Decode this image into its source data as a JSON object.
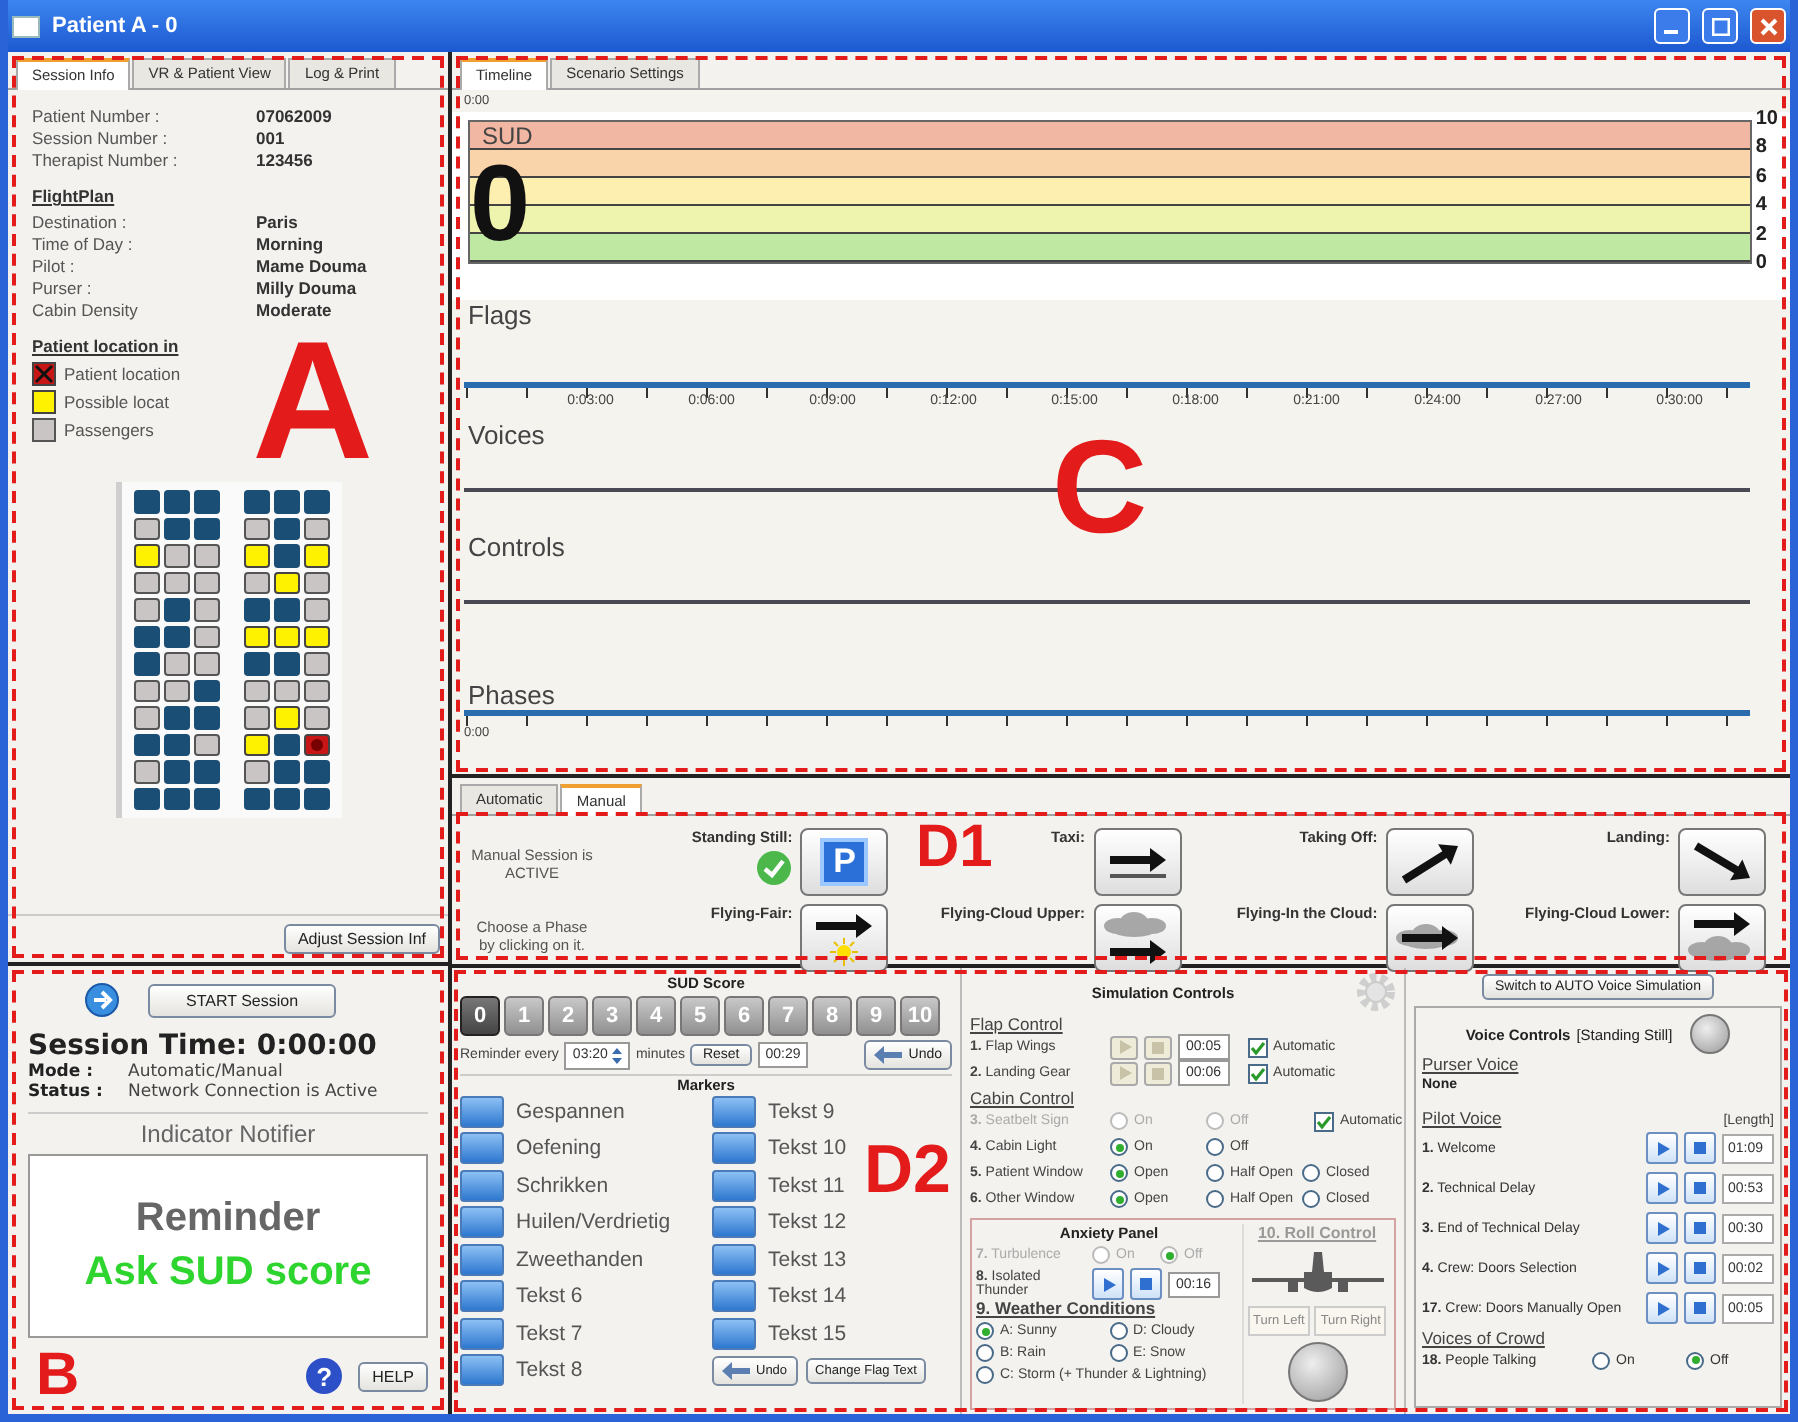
{
  "window": {
    "title": "Patient A - 0"
  },
  "session": {
    "annotation": "A",
    "tabs": [
      {
        "label": "Session Info",
        "selected": true
      },
      {
        "label": "VR & Patient View",
        "selected": false
      },
      {
        "label": "Log & Print",
        "selected": false
      }
    ],
    "info": [
      {
        "label": "Patient Number :",
        "value": "07062009"
      },
      {
        "label": "Session Number :",
        "value": "001"
      },
      {
        "label": "Therapist Number :",
        "value": "123456"
      }
    ],
    "flight_plan": {
      "heading": "FlightPlan",
      "rows": [
        {
          "label": "Destination :",
          "value": "Paris"
        },
        {
          "label": "Time of Day :",
          "value": "Morning"
        },
        {
          "label": "Pilot :",
          "value": "Mame Douma"
        },
        {
          "label": "Purser :",
          "value": "Milly Douma"
        },
        {
          "label": "Cabin Density",
          "value": "Moderate"
        }
      ]
    },
    "location": {
      "heading": "Patient location in",
      "legend": [
        {
          "label": "Patient location",
          "kind": "patient"
        },
        {
          "label": "Possible locat",
          "kind": "possible"
        },
        {
          "label": "Passengers",
          "kind": "passenger"
        }
      ]
    },
    "seat_rows": [
      [
        {
          "kind": "empty"
        },
        {
          "kind": "empty"
        },
        {
          "kind": "empty"
        },
        {
          "kind": "empty"
        },
        {
          "kind": "empty"
        },
        {
          "kind": "empty"
        }
      ],
      [
        {
          "kind": "passenger"
        },
        {
          "kind": "empty"
        },
        {
          "kind": "empty"
        },
        {
          "kind": "passenger"
        },
        {
          "kind": "empty"
        },
        {
          "kind": "passenger"
        }
      ],
      [
        {
          "kind": "possible"
        },
        {
          "kind": "passenger"
        },
        {
          "kind": "passenger"
        },
        {
          "kind": "possible"
        },
        {
          "kind": "empty"
        },
        {
          "kind": "possible"
        }
      ],
      [
        {
          "kind": "passenger"
        },
        {
          "kind": "passenger"
        },
        {
          "kind": "passenger"
        },
        {
          "kind": "passenger"
        },
        {
          "kind": "possible"
        },
        {
          "kind": "passenger"
        }
      ],
      [
        {
          "kind": "passenger"
        },
        {
          "kind": "empty"
        },
        {
          "kind": "passenger"
        },
        {
          "kind": "empty"
        },
        {
          "kind": "empty"
        },
        {
          "kind": "passenger"
        }
      ],
      [
        {
          "kind": "empty"
        },
        {
          "kind": "empty"
        },
        {
          "kind": "passenger"
        },
        {
          "kind": "possible"
        },
        {
          "kind": "possible"
        },
        {
          "kind": "possible"
        }
      ],
      [
        {
          "kind": "empty"
        },
        {
          "kind": "passenger"
        },
        {
          "kind": "passenger"
        },
        {
          "kind": "empty"
        },
        {
          "kind": "empty"
        },
        {
          "kind": "passenger"
        }
      ],
      [
        {
          "kind": "passenger"
        },
        {
          "kind": "passenger"
        },
        {
          "kind": "empty"
        },
        {
          "kind": "passenger"
        },
        {
          "kind": "passenger"
        },
        {
          "kind": "passenger"
        }
      ],
      [
        {
          "kind": "passenger"
        },
        {
          "kind": "empty"
        },
        {
          "kind": "empty"
        },
        {
          "kind": "passenger"
        },
        {
          "kind": "possible"
        },
        {
          "kind": "passenger"
        }
      ],
      [
        {
          "kind": "empty"
        },
        {
          "kind": "empty"
        },
        {
          "kind": "passenger"
        },
        {
          "kind": "possible"
        },
        {
          "kind": "empty"
        },
        {
          "kind": "patient"
        }
      ],
      [
        {
          "kind": "passenger"
        },
        {
          "kind": "empty"
        },
        {
          "kind": "empty"
        },
        {
          "kind": "passenger"
        },
        {
          "kind": "empty"
        },
        {
          "kind": "empty"
        }
      ],
      [
        {
          "kind": "empty"
        },
        {
          "kind": "empty"
        },
        {
          "kind": "empty"
        },
        {
          "kind": "empty"
        },
        {
          "kind": "empty"
        },
        {
          "kind": "empty"
        }
      ]
    ],
    "adjust_button": "Adjust Session Inf"
  },
  "session_control": {
    "annotation": "B",
    "start_button": "START Session",
    "session_time": "Session Time: 0:00:00",
    "status": [
      {
        "label": "Mode :",
        "value": "Automatic/Manual"
      },
      {
        "label": "Status :",
        "value": "Network Connection is Active"
      }
    ],
    "notifier": {
      "title": "Indicator Notifier",
      "reminder": "Reminder",
      "message": "Ask SUD score"
    },
    "help_glyph": "?",
    "help_button": "HELP"
  },
  "timeline": {
    "annotation": "C",
    "tabs": [
      {
        "label": "Timeline",
        "selected": true
      },
      {
        "label": "Scenario Settings",
        "selected": false
      }
    ],
    "start_label_top": "0:00",
    "sud": {
      "label": "SUD",
      "value": "0",
      "ticks": [
        "10",
        "8",
        "6",
        "4",
        "2",
        "0"
      ]
    },
    "lanes": [
      {
        "label": "Flags",
        "kind": "axis"
      },
      {
        "label": "Voices",
        "kind": "line"
      },
      {
        "label": "Controls",
        "kind": "line"
      },
      {
        "label": "Phases",
        "kind": "bottom_axis"
      }
    ],
    "axis_labels": [
      "0:03:00",
      "0:06:00",
      "0:09:00",
      "0:12:00",
      "0:15:00",
      "0:18:00",
      "0:21:00",
      "0:24:00",
      "0:27:00",
      "0:30:00"
    ],
    "start_label_bottom": "0:00"
  },
  "phase_panel": {
    "annotation": "D1",
    "tabs": [
      {
        "label": "Automatic",
        "selected": false
      },
      {
        "label": "Manual",
        "selected": true
      }
    ],
    "status": "Manual Session is ACTIVE",
    "hint": "Choose a Phase by clicking on it.",
    "phases": [
      {
        "label": "Standing Still:",
        "kind": "parking",
        "badge": "P",
        "active": true
      },
      {
        "label": "Taxi:",
        "kind": "taxi",
        "active": false
      },
      {
        "label": "Taking Off:",
        "kind": "takeoff",
        "active": false
      },
      {
        "label": "Landing:",
        "kind": "landing",
        "active": false
      },
      {
        "label": "Flying-Fair:",
        "kind": "fair",
        "active": false
      },
      {
        "label": "Flying-Cloud Upper:",
        "kind": "cloud_upper",
        "active": false
      },
      {
        "label": "Flying-In the Cloud:",
        "kind": "in_cloud",
        "active": false
      },
      {
        "label": "Flying-Cloud Lower:",
        "kind": "cloud_lower",
        "active": false
      }
    ]
  },
  "controls": {
    "annotation": "D2",
    "sud_score": {
      "heading": "SUD Score",
      "buttons": [
        {
          "label": "0",
          "selected": true
        },
        {
          "label": "1",
          "selected": false
        },
        {
          "label": "2",
          "selected": false
        },
        {
          "label": "3",
          "selected": false
        },
        {
          "label": "4",
          "selected": false
        },
        {
          "label": "5",
          "selected": false
        },
        {
          "label": "6",
          "selected": false
        },
        {
          "label": "7",
          "selected": false
        },
        {
          "label": "8",
          "selected": false
        },
        {
          "label": "9",
          "selected": false
        },
        {
          "label": "10",
          "selected": false
        }
      ]
    },
    "reminder": {
      "label": "Reminder every",
      "value": "03:20",
      "unit": "minutes",
      "reset": "Reset",
      "timer": "00:29",
      "undo": "Undo"
    },
    "markers": {
      "heading": "Markers",
      "left": [
        "Gespannen",
        "Oefening",
        "Schrikken",
        "Huilen/Verdrietig",
        "Zweethanden",
        "Tekst 6",
        "Tekst 7",
        "Tekst 8"
      ],
      "right": [
        "Tekst 9",
        "Tekst 10",
        "Tekst 11",
        "Tekst 12",
        "Tekst 13",
        "Tekst 14",
        "Tekst 15"
      ],
      "undo": "Undo",
      "change": "Change Flag Text"
    },
    "simulation": {
      "title": "Simulation Controls",
      "sections": [
        {
          "heading": "Flap Control",
          "rows": [
            {
              "kind": "timed",
              "label": "**1.** Flap Wings",
              "time": "00:05",
              "automatic": true,
              "auto_label": "Automatic"
            },
            {
              "kind": "timed",
              "label": "**2.** Landing Gear",
              "time": "00:06",
              "automatic": true,
              "auto_label": "Automatic"
            }
          ]
        },
        {
          "heading": "Cabin Control",
          "rows": [
            {
              "kind": "radio",
              "label": "**3.** Seatbelt Sign",
              "disabled": true,
              "options": [
                {
                  "label": "On",
                  "selected": false
                },
                {
                  "label": "Off",
                  "selected": false
                }
              ],
              "automatic": true,
              "auto_label": "Automatic"
            },
            {
              "kind": "radio",
              "label": "**4.** Cabin Light",
              "disabled": false,
              "options": [
                {
                  "label": "On",
                  "selected": true
                },
                {
                  "label": "Off",
                  "selected": false
                }
              ]
            },
            {
              "kind": "radio",
              "label": "**5.** Patient Window",
              "disabled": false,
              "options": [
                {
                  "label": "Open",
                  "selected": true
                },
                {
                  "label": "Half Open",
                  "selected": false
                },
                {
                  "label": "Closed",
                  "selected": false
                }
              ]
            },
            {
              "kind": "radio",
              "label": "**6.** Other Window",
              "disabled": false,
              "options": [
                {
                  "label": "Open",
                  "selected": true
                },
                {
                  "label": "Half Open",
                  "selected": false
                },
                {
                  "label": "Closed",
                  "selected": false
                }
              ]
            }
          ]
        }
      ]
    },
    "anxiety": {
      "title": "Anxiety Panel",
      "rows": [
        {
          "kind": "radio",
          "label": "**7.** Turbulence",
          "disabled": true,
          "options": [
            {
              "label": "On",
              "selected": false
            },
            {
              "label": "Off",
              "selected": true
            }
          ]
        },
        {
          "kind": "timed",
          "label": "**8.** Isolated Thunder",
          "time": "00:16"
        }
      ],
      "weather": {
        "heading": "9. Weather Conditions",
        "options": [
          {
            "label": "A: Sunny",
            "selected": true
          },
          {
            "label": "D: Cloudy",
            "selected": false
          },
          {
            "label": "B: Rain",
            "selected": false
          },
          {
            "label": "E: Snow",
            "selected": false
          },
          {
            "label": "C: Storm (+ Thunder & Lightning)",
            "selected": false
          }
        ]
      },
      "roll": {
        "heading": "10. Roll Control",
        "left": "Turn Left",
        "right": "Turn Right"
      }
    },
    "voice": {
      "switch_button": "Switch to AUTO Voice Simulation",
      "title": "Voice Controls",
      "context": "[Standing Still]",
      "purser": {
        "heading": "Purser Voice",
        "value": "None"
      },
      "pilot": {
        "heading": "Pilot Voice",
        "length_label": "[Length]",
        "rows": [
          {
            "label": "**1.** Welcome",
            "length": "01:09"
          },
          {
            "label": "**2.** Technical Delay",
            "length": "00:53"
          },
          {
            "label": "**3.** End of Technical Delay",
            "length": "00:30"
          },
          {
            "label": "**4.** Crew: Doors Selection",
            "length": "00:02"
          },
          {
            "label": "**17.** Crew: Doors Manually Open",
            "length": "00:05"
          }
        ]
      },
      "crowd": {
        "heading": "Voices of Crowd",
        "label": "**18.** People Talking",
        "options": [
          {
            "label": "On",
            "selected": false
          },
          {
            "label": "Off",
            "selected": true
          }
        ]
      }
    }
  }
}
